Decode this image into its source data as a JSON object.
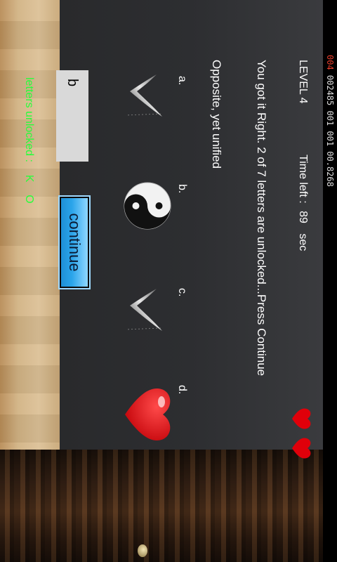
{
  "status": {
    "red_prefix": "004",
    "readout": " 002485 001 001 00.8268"
  },
  "game": {
    "level": "LEVEL 4",
    "timer_label": "Time left :",
    "timer_value": "89",
    "timer_unit": "sec",
    "message": "You got it Right. 2 of 7 letters are unlocked...Press Continue",
    "clue": "Opposite, yet unified",
    "options": [
      {
        "label": "a.",
        "icon": "checkmark-swoosh-icon"
      },
      {
        "label": "b.",
        "icon": "yin-yang-icon"
      },
      {
        "label": "c.",
        "icon": "checkmark-swoosh-icon"
      },
      {
        "label": "d.",
        "icon": "heart-icon"
      }
    ],
    "answer_value": "b",
    "continue_label": "continue",
    "unlocked_label": "letters unlocked :",
    "unlocked_letters": "K    O",
    "lives_remaining": 2,
    "colors": {
      "accent_green": "#27ff3a",
      "button_blue": "#2aa4ea",
      "heart_red": "#e0000a",
      "status_red": "#e43c2a"
    }
  }
}
